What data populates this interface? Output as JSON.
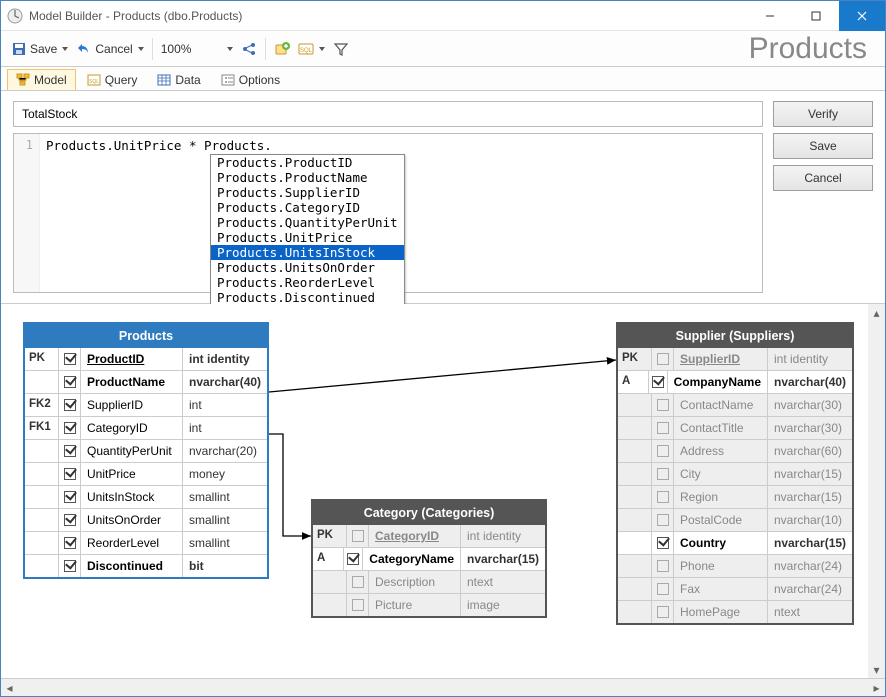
{
  "window": {
    "title": "Model Builder - Products (dbo.Products)"
  },
  "toolbar": {
    "save_label": "Save",
    "cancel_label": "Cancel",
    "zoom": "100%"
  },
  "page_heading": "Products",
  "tabs": {
    "model": "Model",
    "query": "Query",
    "data": "Data",
    "options": "Options"
  },
  "editor": {
    "field_name": "TotalStock",
    "line_no": "1",
    "code": "Products.UnitPrice * Products.",
    "buttons": {
      "verify": "Verify",
      "save": "Save",
      "cancel": "Cancel"
    },
    "autocomplete": [
      "Products.ProductID",
      "Products.ProductName",
      "Products.SupplierID",
      "Products.CategoryID",
      "Products.QuantityPerUnit",
      "Products.UnitPrice",
      "Products.UnitsInStock",
      "Products.UnitsOnOrder",
      "Products.ReorderLevel",
      "Products.Discontinued"
    ],
    "autocomplete_selected_index": 6
  },
  "entities": {
    "products": {
      "title": "Products",
      "rows": [
        {
          "key": "PK",
          "chk": true,
          "name": "ProductID",
          "type": "int identity",
          "pk": true,
          "bold": true
        },
        {
          "key": "",
          "chk": true,
          "name": "ProductName",
          "type": "nvarchar(40)",
          "bold": true
        },
        {
          "key": "FK2",
          "chk": true,
          "name": "SupplierID",
          "type": "int"
        },
        {
          "key": "FK1",
          "chk": true,
          "name": "CategoryID",
          "type": "int"
        },
        {
          "key": "",
          "chk": true,
          "name": "QuantityPerUnit",
          "type": "nvarchar(20)"
        },
        {
          "key": "",
          "chk": true,
          "name": "UnitPrice",
          "type": "money"
        },
        {
          "key": "",
          "chk": true,
          "name": "UnitsInStock",
          "type": "smallint"
        },
        {
          "key": "",
          "chk": true,
          "name": "UnitsOnOrder",
          "type": "smallint"
        },
        {
          "key": "",
          "chk": true,
          "name": "ReorderLevel",
          "type": "smallint"
        },
        {
          "key": "",
          "chk": true,
          "name": "Discontinued",
          "type": "bit",
          "bold": true
        }
      ]
    },
    "category": {
      "title": "Category (Categories)",
      "rows": [
        {
          "key": "PK",
          "chk": false,
          "name": "CategoryID",
          "type": "int identity",
          "pk": true,
          "dim": true
        },
        {
          "key": "A",
          "chk": true,
          "name": "CategoryName",
          "type": "nvarchar(15)",
          "bold": true
        },
        {
          "key": "",
          "chk": false,
          "name": "Description",
          "type": "ntext",
          "dim": true
        },
        {
          "key": "",
          "chk": false,
          "name": "Picture",
          "type": "image",
          "dim": true
        }
      ]
    },
    "supplier": {
      "title": "Supplier (Suppliers)",
      "rows": [
        {
          "key": "PK",
          "chk": false,
          "name": "SupplierID",
          "type": "int identity",
          "pk": true,
          "dim": true
        },
        {
          "key": "A",
          "chk": true,
          "name": "CompanyName",
          "type": "nvarchar(40)",
          "bold": true
        },
        {
          "key": "",
          "chk": false,
          "name": "ContactName",
          "type": "nvarchar(30)",
          "dim": true
        },
        {
          "key": "",
          "chk": false,
          "name": "ContactTitle",
          "type": "nvarchar(30)",
          "dim": true
        },
        {
          "key": "",
          "chk": false,
          "name": "Address",
          "type": "nvarchar(60)",
          "dim": true
        },
        {
          "key": "",
          "chk": false,
          "name": "City",
          "type": "nvarchar(15)",
          "dim": true
        },
        {
          "key": "",
          "chk": false,
          "name": "Region",
          "type": "nvarchar(15)",
          "dim": true
        },
        {
          "key": "",
          "chk": false,
          "name": "PostalCode",
          "type": "nvarchar(10)",
          "dim": true
        },
        {
          "key": "",
          "chk": true,
          "name": "Country",
          "type": "nvarchar(15)",
          "bold": true
        },
        {
          "key": "",
          "chk": false,
          "name": "Phone",
          "type": "nvarchar(24)",
          "dim": true
        },
        {
          "key": "",
          "chk": false,
          "name": "Fax",
          "type": "nvarchar(24)",
          "dim": true
        },
        {
          "key": "",
          "chk": false,
          "name": "HomePage",
          "type": "ntext",
          "dim": true
        }
      ]
    }
  }
}
